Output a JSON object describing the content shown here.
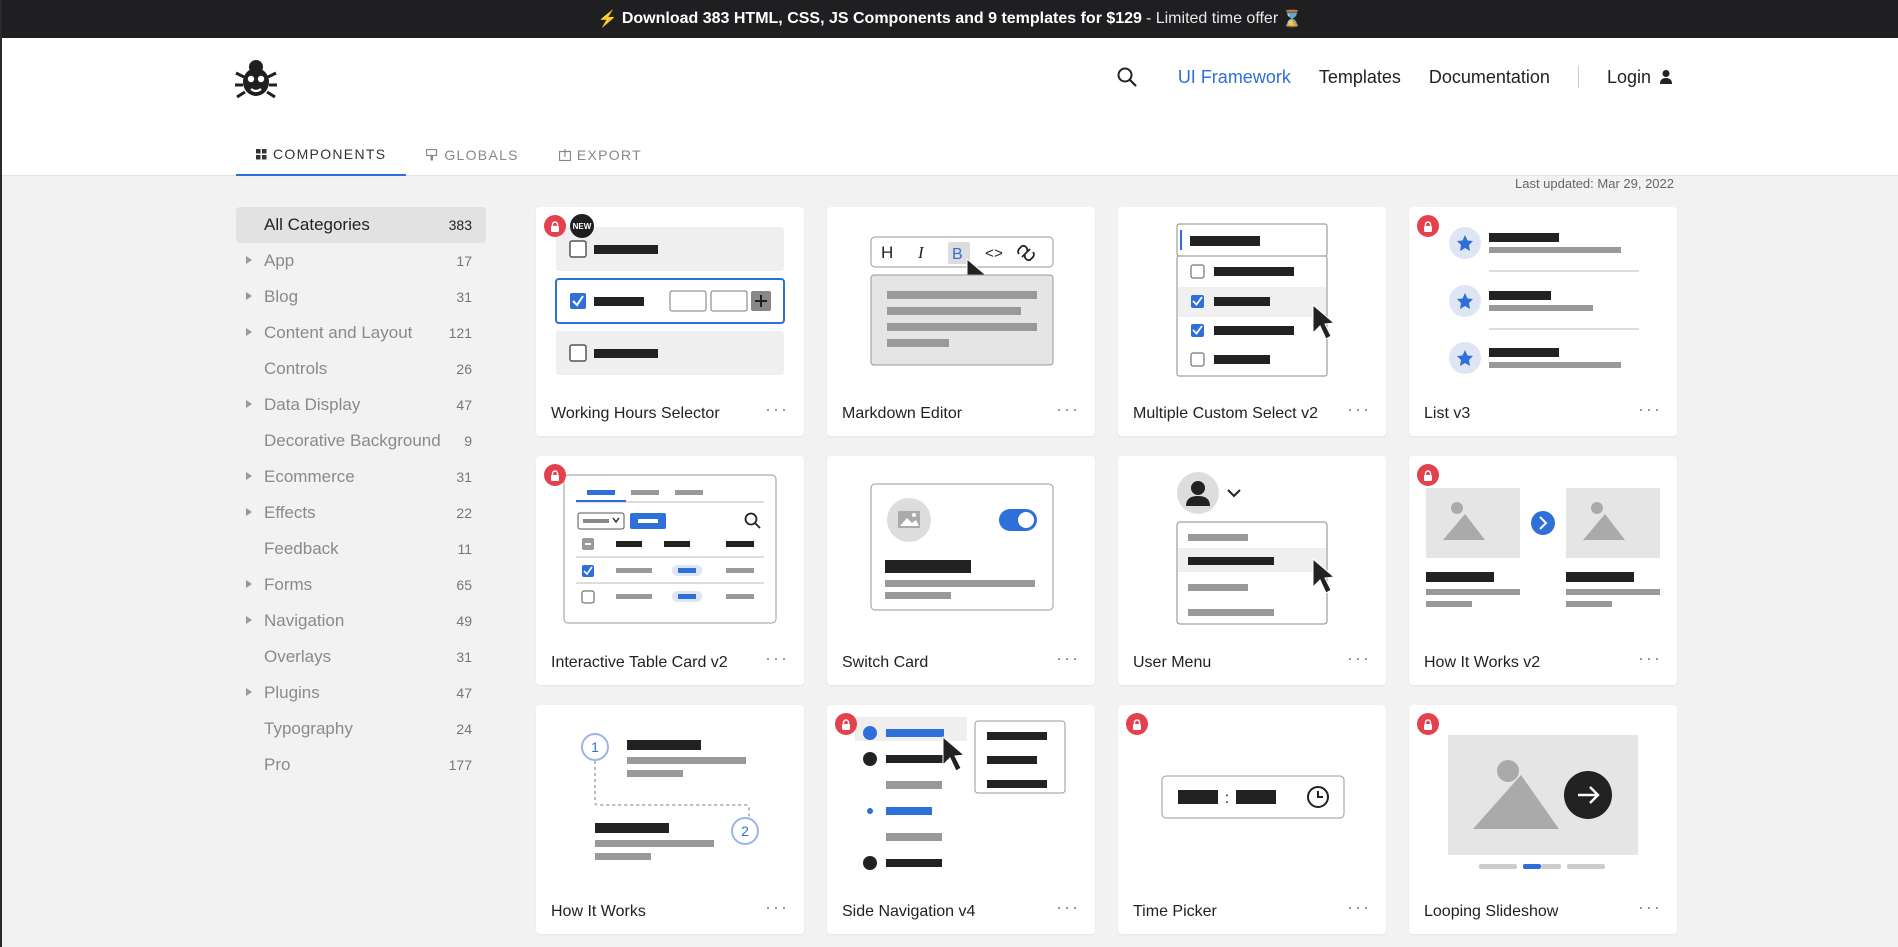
{
  "banner": {
    "icon": "lightning-icon",
    "bold_text": "Download 383 HTML, CSS, JS Components and 9 templates for $129",
    "light_text": " - Limited time offer",
    "end_icon": "hourglass-icon"
  },
  "header": {
    "nav": {
      "framework": "UI Framework",
      "templates": "Templates",
      "documentation": "Documentation",
      "login": "Login"
    },
    "tabs": [
      "COMPONENTS",
      "GLOBALS",
      "EXPORT"
    ],
    "last_updated": "Last updated: Mar 29, 2022"
  },
  "sidebar": {
    "items": [
      {
        "label": "All Categories",
        "count": "383"
      },
      {
        "label": "App",
        "count": "17"
      },
      {
        "label": "Blog",
        "count": "31"
      },
      {
        "label": "Content and Layout",
        "count": "121"
      },
      {
        "label": "Controls",
        "count": "26"
      },
      {
        "label": "Data Display",
        "count": "47"
      },
      {
        "label": "Decorative Background",
        "count": "9"
      },
      {
        "label": "Ecommerce",
        "count": "31"
      },
      {
        "label": "Effects",
        "count": "22"
      },
      {
        "label": "Feedback",
        "count": "11"
      },
      {
        "label": "Forms",
        "count": "65"
      },
      {
        "label": "Navigation",
        "count": "49"
      },
      {
        "label": "Overlays",
        "count": "31"
      },
      {
        "label": "Plugins",
        "count": "47"
      },
      {
        "label": "Typography",
        "count": "24"
      },
      {
        "label": "Pro",
        "count": "177"
      }
    ]
  },
  "cards": [
    {
      "title": "Working Hours Selector",
      "more": "···",
      "new_label": "NEW"
    },
    {
      "title": "Markdown Editor",
      "more": "···"
    },
    {
      "title": "Multiple Custom Select v2",
      "more": "···"
    },
    {
      "title": "List v3",
      "more": "···"
    },
    {
      "title": "Interactive Table Card v2",
      "more": "···"
    },
    {
      "title": "Switch Card",
      "more": "···"
    },
    {
      "title": "User Menu",
      "more": "···"
    },
    {
      "title": "How It Works v2",
      "more": "···"
    },
    {
      "title": "How It Works",
      "more": "···",
      "step1": "1",
      "step2": "2"
    },
    {
      "title": "Side Navigation v4",
      "more": "···"
    },
    {
      "title": "Time Picker",
      "more": "···",
      "sep": ":"
    },
    {
      "title": "Looping Slideshow",
      "more": "···"
    }
  ],
  "markdown_toolbar": [
    "H",
    "I",
    "B",
    "<>",
    "link-icon"
  ],
  "colors": {
    "accent": "#2e6fd9",
    "lock": "#e4404d",
    "dark": "#1f1f22"
  }
}
